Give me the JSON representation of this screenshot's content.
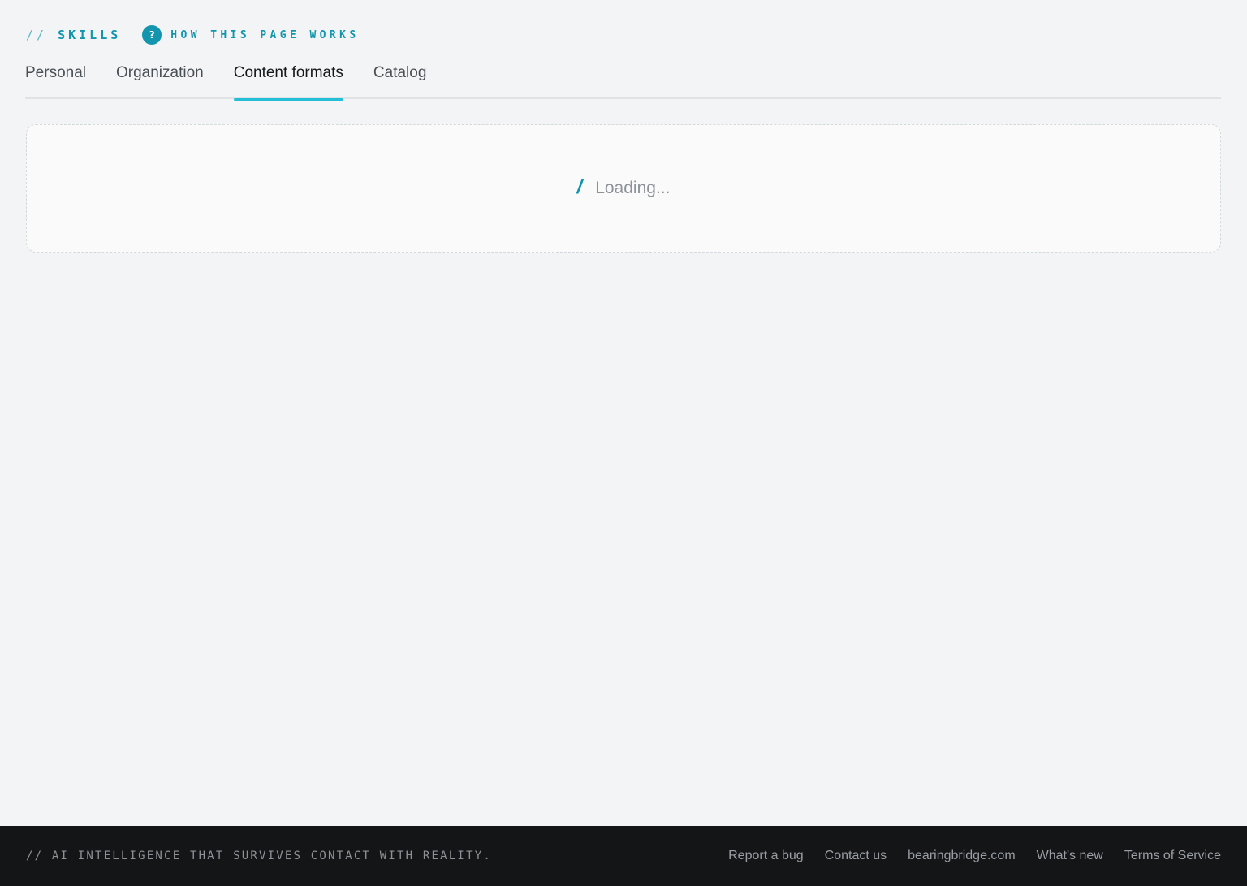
{
  "header": {
    "section_prefix": "//",
    "section_title": "SKILLS",
    "help_icon_glyph": "?",
    "help_label": "HOW THIS PAGE WORKS",
    "accent_color": "#1396ad"
  },
  "tabs": [
    {
      "label": "Personal",
      "active": false
    },
    {
      "label": "Organization",
      "active": false
    },
    {
      "label": "Content formats",
      "active": true
    },
    {
      "label": "Catalog",
      "active": false
    }
  ],
  "main": {
    "loading_icon": "/",
    "loading_text": "Loading..."
  },
  "footer": {
    "tagline": "// AI INTELLIGENCE THAT SURVIVES CONTACT WITH REALITY.",
    "links": [
      "Report a bug",
      "Contact us",
      "bearingbridge.com",
      "What's new",
      "Terms of Service"
    ]
  },
  "colors": {
    "tab_underline": "#22bfd6",
    "background": "#f2f4f5",
    "footer_background": "#141517"
  }
}
